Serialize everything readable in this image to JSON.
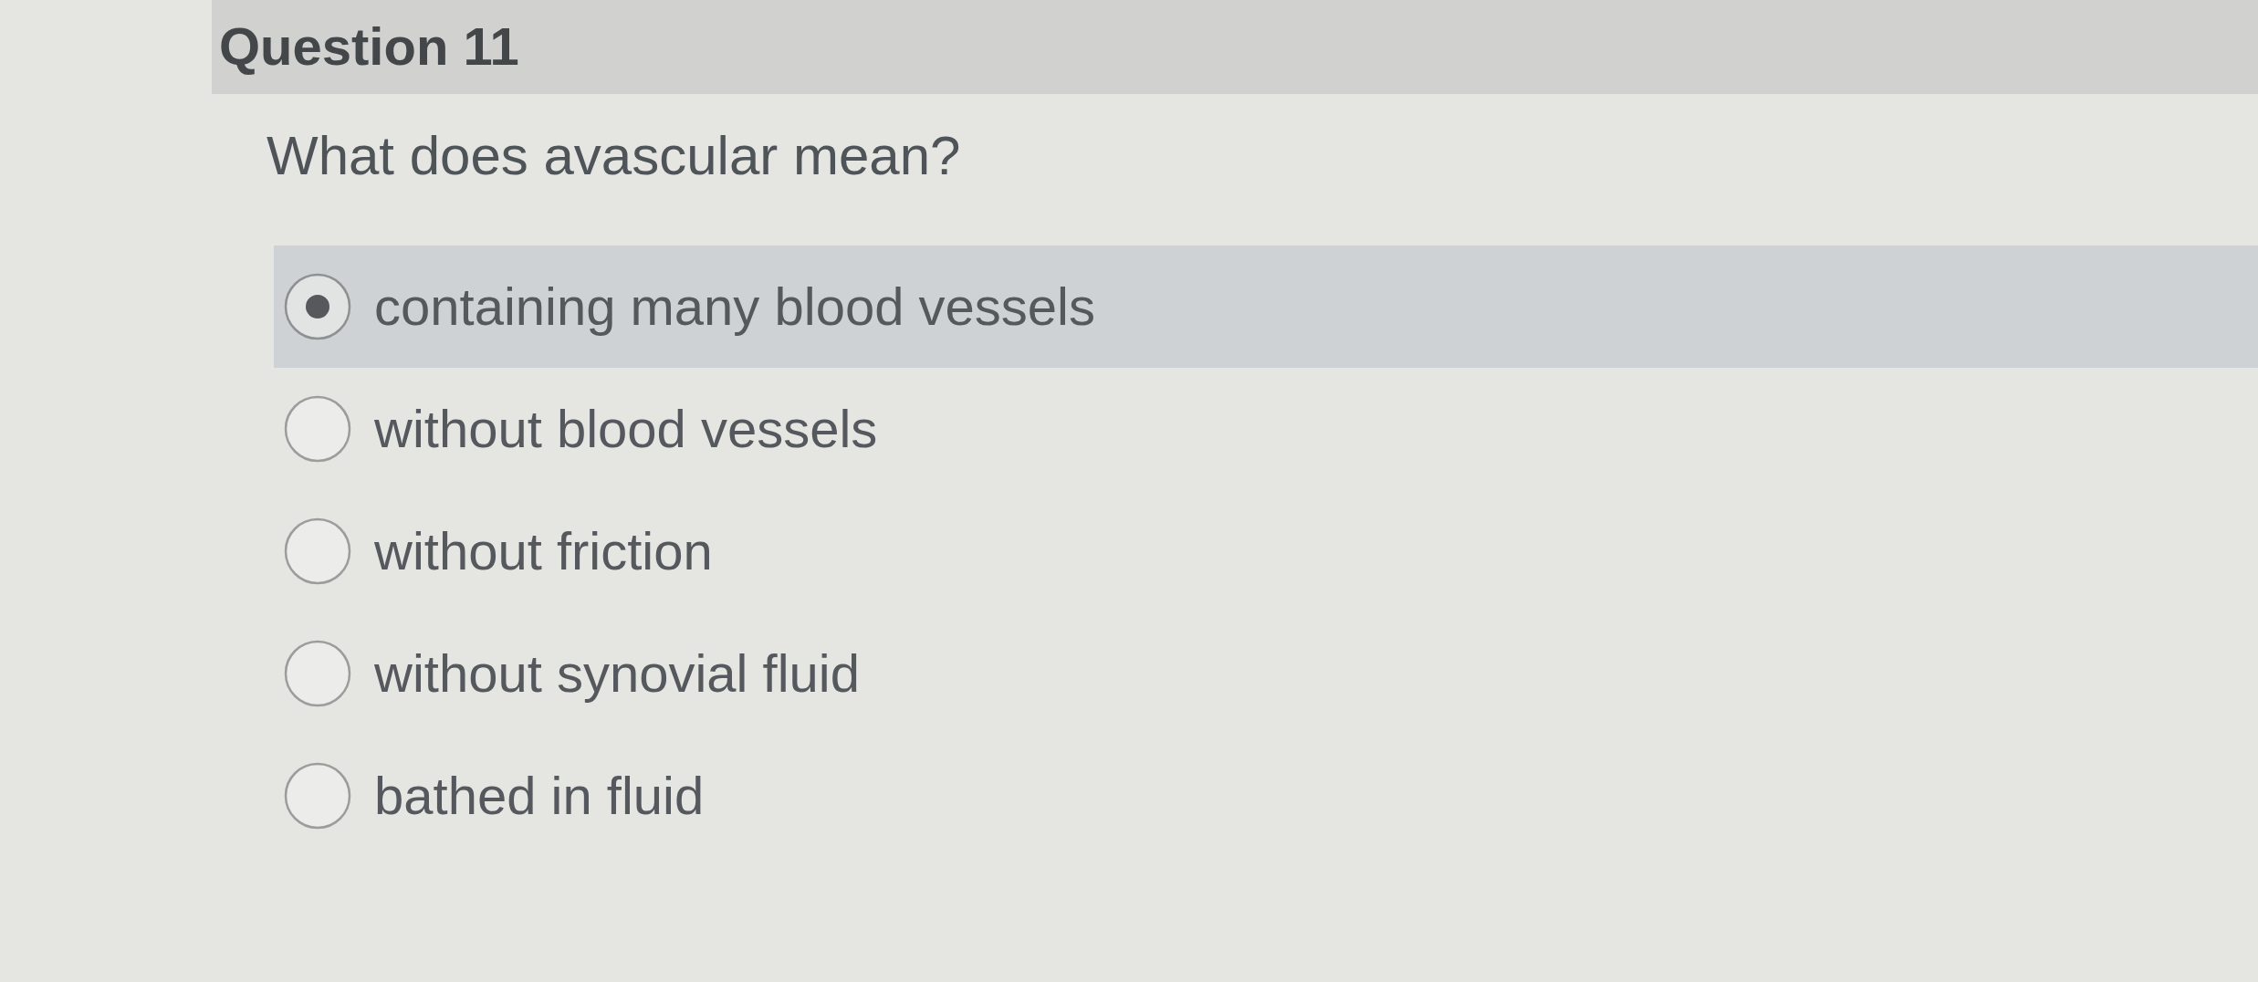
{
  "question": {
    "header": "Question 11",
    "text": "What does avascular mean?"
  },
  "options": [
    {
      "label": "containing many blood vessels",
      "selected": true
    },
    {
      "label": "without blood vessels",
      "selected": false
    },
    {
      "label": "without friction",
      "selected": false
    },
    {
      "label": "without synovial fluid",
      "selected": false
    },
    {
      "label": "bathed in fluid",
      "selected": false
    }
  ]
}
